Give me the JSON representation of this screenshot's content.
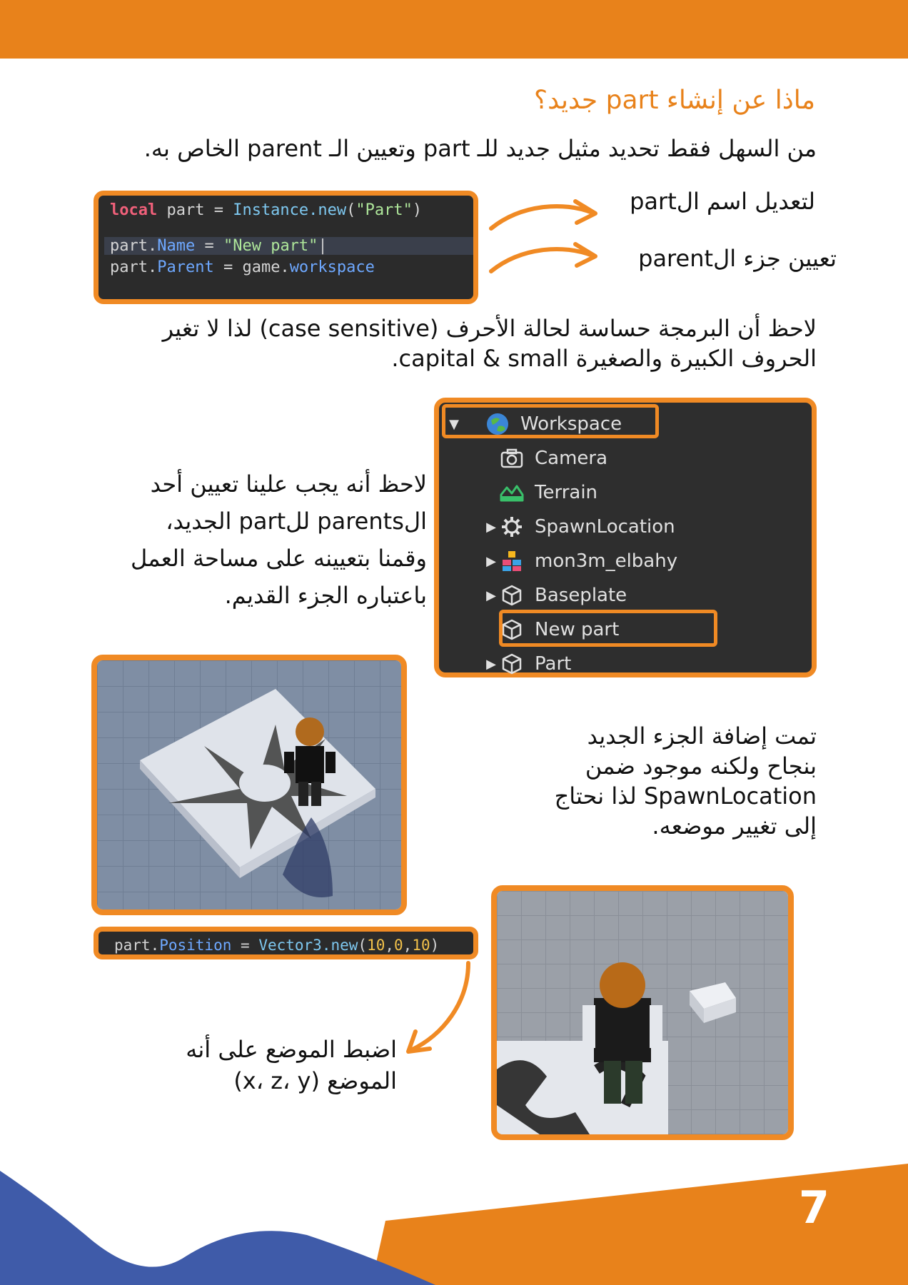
{
  "heading": "ماذا عن إنشاء part جديد؟",
  "intro": "من السهل فقط تحديد مثيل جديد للـ part وتعيين الـ parent الخاص به.",
  "code1": {
    "line1": {
      "kw": "local",
      "a": " part = ",
      "fn": "Instance.new",
      "b": "(",
      "str": "\"Part\"",
      "c": ")"
    },
    "line2": {
      "a": "part.",
      "prop": "Name",
      "b": " = ",
      "str": "\"New part\""
    },
    "line3": {
      "a": "part.",
      "prop": "Parent",
      "b": " = game.",
      "fn": "workspace"
    }
  },
  "annotations": {
    "rename": "لتعديل اسم الpart",
    "set_parent": "تعيين جزء الparent"
  },
  "case_note_line1": "لاحظ أن البرمجة حساسة لحالة الأحرف (case sensitive) لذا لا تغير",
  "case_note_line2": "الحروف الكبيرة والصغيرة capital & small.",
  "parents_note": [
    "لاحظ أنه يجب علينا تعيين أحد",
    "الparents للpart الجديد،",
    "وقمنا بتعيينه على مساحة العمل",
    "باعتباره الجزء القديم."
  ],
  "explorer": {
    "items": [
      {
        "label": "Workspace",
        "icon": "globe-icon",
        "expanded": true
      },
      {
        "label": "Camera",
        "icon": "camera-icon"
      },
      {
        "label": "Terrain",
        "icon": "terrain-icon"
      },
      {
        "label": "SpawnLocation",
        "icon": "gear-icon",
        "collapsed": true
      },
      {
        "label": "mon3m_elbahy",
        "icon": "avatar-icon",
        "collapsed": true
      },
      {
        "label": "Baseplate",
        "icon": "cube-icon",
        "collapsed": true
      },
      {
        "label": "New part",
        "icon": "cube-icon"
      },
      {
        "label": "Part",
        "icon": "cube-icon",
        "collapsed": true
      }
    ]
  },
  "added_note": [
    "تمت إضافة الجزء الجديد",
    "بنجاح ولكنه موجود ضمن",
    "SpawnLocation لذا نحتاج",
    "إلى تغيير موضعه."
  ],
  "code2": {
    "a": "part.",
    "prop": "Position",
    "b": " = ",
    "fn": "Vector3.new",
    "c": "(",
    "n1": "10",
    "d": ",",
    "n2": "0",
    "e": ",",
    "n3": "10",
    "f": ")"
  },
  "position_note": [
    "اضبط الموضع على أنه",
    "الموضع (x، z، y)"
  ],
  "page_number": "7",
  "colors": {
    "orange": "#e8821b",
    "blue": "#3f5ba9"
  }
}
